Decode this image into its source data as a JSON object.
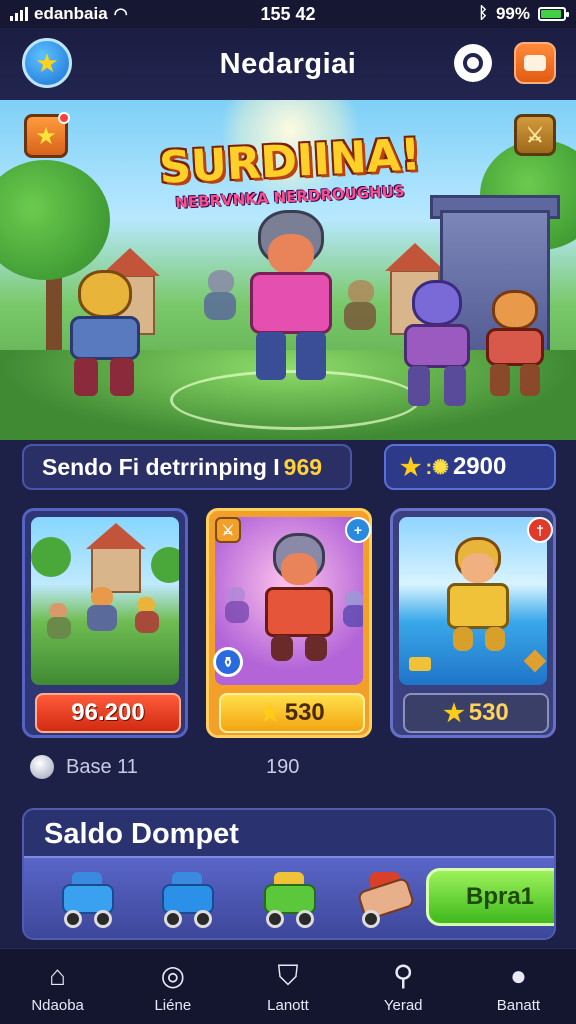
{
  "status_bar": {
    "carrier": "edanbaia",
    "time": "155 42",
    "battery_text": "99%",
    "battery_level": 0.9
  },
  "header": {
    "title": "Nedargiai"
  },
  "banner": {
    "title": "SURDIINA!",
    "subtitle": "NEBRVNKA NERDROUGHUS"
  },
  "info": {
    "label": "Sendo Fi detrrinping I",
    "number": "969",
    "coins": "2900"
  },
  "cards": [
    {
      "price": "96.200"
    },
    {
      "price": "530"
    },
    {
      "price": "530"
    }
  ],
  "base": {
    "label": "Base 11",
    "count": "190"
  },
  "wallet": {
    "title": "Saldo Dompet",
    "button_label": "Bpra1"
  },
  "nav": [
    {
      "label": "Ndaoba",
      "icon": "home-icon"
    },
    {
      "label": "Liéne",
      "icon": "headset-icon"
    },
    {
      "label": "Lanott",
      "icon": "shield-icon"
    },
    {
      "label": "Yerad",
      "icon": "search-icon"
    },
    {
      "label": "Banatt",
      "icon": "profile-icon"
    }
  ],
  "colors": {
    "background": "#1e2147",
    "accent_green": "#3fb81e",
    "accent_orange": "#e25b12",
    "gold": "#ffcc1a"
  }
}
